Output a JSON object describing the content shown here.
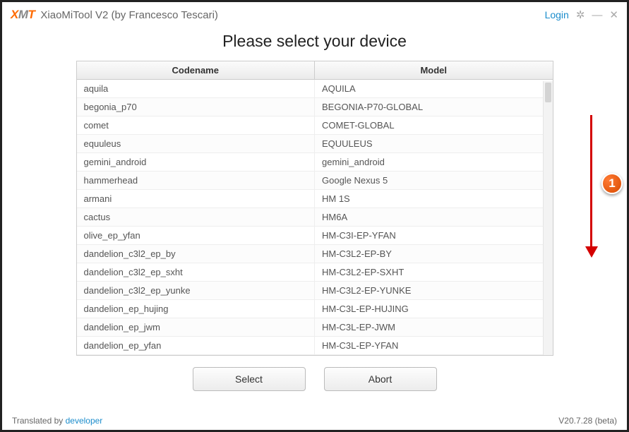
{
  "titlebar": {
    "logo_x": "X",
    "logo_m": "M",
    "logo_t": "T",
    "app_title": "XiaoMiTool V2 (by Francesco Tescari)",
    "login": "Login"
  },
  "heading": "Please select your device",
  "columns": {
    "codename": "Codename",
    "model": "Model"
  },
  "rows": [
    {
      "codename": "aquila",
      "model": "AQUILA"
    },
    {
      "codename": "begonia_p70",
      "model": "BEGONIA-P70-GLOBAL"
    },
    {
      "codename": "comet",
      "model": "COMET-GLOBAL"
    },
    {
      "codename": "equuleus",
      "model": "EQUULEUS"
    },
    {
      "codename": "gemini_android",
      "model": "gemini_android"
    },
    {
      "codename": "hammerhead",
      "model": "Google Nexus 5"
    },
    {
      "codename": "armani",
      "model": "HM 1S"
    },
    {
      "codename": "cactus",
      "model": "HM6A"
    },
    {
      "codename": "olive_ep_yfan",
      "model": "HM-C3I-EP-YFAN"
    },
    {
      "codename": "dandelion_c3l2_ep_by",
      "model": "HM-C3L2-EP-BY"
    },
    {
      "codename": "dandelion_c3l2_ep_sxht",
      "model": "HM-C3L2-EP-SXHT"
    },
    {
      "codename": "dandelion_c3l2_ep_yunke",
      "model": "HM-C3L2-EP-YUNKE"
    },
    {
      "codename": "dandelion_ep_hujing",
      "model": "HM-C3L-EP-HUJING"
    },
    {
      "codename": "dandelion_ep_jwm",
      "model": "HM-C3L-EP-JWM"
    },
    {
      "codename": "dandelion_ep_yfan",
      "model": "HM-C3L-EP-YFAN"
    }
  ],
  "buttons": {
    "select": "Select",
    "abort": "Abort"
  },
  "footer": {
    "translated_prefix": "Translated by ",
    "translated_link": "developer",
    "version": "V20.7.28 (beta)"
  },
  "annotation": {
    "badge": "1"
  }
}
